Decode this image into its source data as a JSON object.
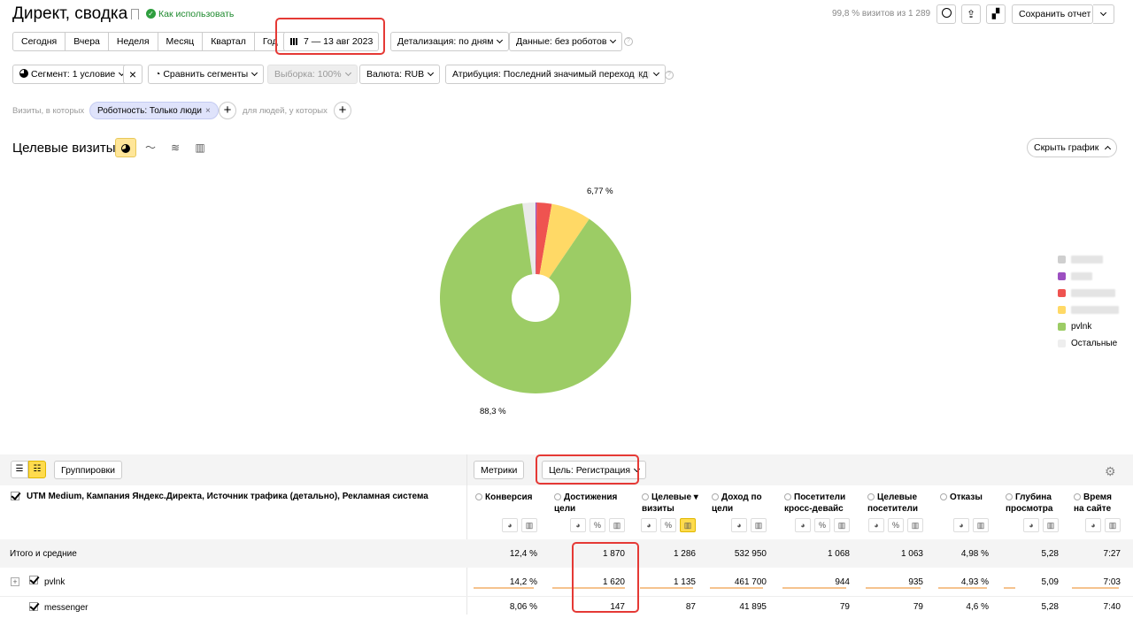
{
  "header": {
    "title": "Директ, сводка",
    "help_link": "Как использовать",
    "visits_info": "99,8 % визитов из 1 289",
    "save_label": "Сохранить отчет"
  },
  "periods": [
    "Сегодня",
    "Вчера",
    "Неделя",
    "Месяц",
    "Квартал",
    "Год"
  ],
  "date_range": "7 — 13 авг 2023",
  "detail": "Детализация: по дням",
  "data_filter": "Данные: без роботов",
  "filters": {
    "segment": "Сегмент: 1 условие",
    "compare": "Сравнить сегменты",
    "sample": "Выборка: 100%",
    "currency": "Валюта: RUB",
    "attribution": "Атрибуция: Последний значимый переход",
    "attribution_badge": "КД"
  },
  "conditions": {
    "prefix": "Визиты, в которых",
    "tag": "Роботность: Только люди",
    "people": "для людей, у которых"
  },
  "chart_section": {
    "title": "Целевые визиты",
    "hide_label": "Скрыть график"
  },
  "chart_data": {
    "type": "pie",
    "slices": [
      {
        "name": "pvlnk",
        "value": 88.3,
        "color": "#9ccc65",
        "label": "88,3 %"
      },
      {
        "name": "",
        "value": 2.2,
        "color": "#eaeaea",
        "label": ""
      },
      {
        "name": "",
        "value": 0.2,
        "color": "#9c4fc1",
        "label": ""
      },
      {
        "name": "",
        "value": 2.53,
        "color": "#ef5350",
        "label": ""
      },
      {
        "name": "",
        "value": 6.77,
        "color": "#ffd966",
        "label": "6,77 %"
      }
    ],
    "legend": [
      {
        "label": "",
        "color": "#cfcfcf",
        "blur": 36
      },
      {
        "label": "",
        "color": "#9c4fc1",
        "blur": 24
      },
      {
        "label": "",
        "color": "#ef5350",
        "blur": 50
      },
      {
        "label": "",
        "color": "#ffd966",
        "blur": 54
      },
      {
        "label": "pvlnk",
        "color": "#9ccc65",
        "blur": 0
      },
      {
        "label": "Остальные",
        "color": "#eeeeee",
        "blur": 0
      }
    ]
  },
  "table_toolbar": {
    "groups": "Группировки",
    "metrics": "Метрики",
    "goal": "Цель: Регистрация"
  },
  "table": {
    "group_header": "UTM Medium, Кампания Яндекс.Директа, Источник трафика (детально), Рекламная система",
    "columns": [
      {
        "l1": "Конверсия",
        "l2": ""
      },
      {
        "l1": "Достижения",
        "l2": "цели"
      },
      {
        "l1": "Целевые",
        "l2": "визиты"
      },
      {
        "l1": "Доход по",
        "l2": "цели"
      },
      {
        "l1": "Посетители",
        "l2": "кросс-девайс"
      },
      {
        "l1": "Целевые",
        "l2": "посетители"
      },
      {
        "l1": "Отказы",
        "l2": ""
      },
      {
        "l1": "Глубина",
        "l2": "просмотра"
      },
      {
        "l1": "Время",
        "l2": "на сайте"
      }
    ],
    "totals": {
      "label": "Итого и средние",
      "values": [
        "12,4 %",
        "1 870",
        "1 286",
        "532 950",
        "1 068",
        "1 063",
        "4,98 %",
        "5,28",
        "7:27"
      ]
    },
    "rows": [
      {
        "label": "pvlnk",
        "values": [
          "14,2 %",
          "1 620",
          "1 135",
          "461 700",
          "944",
          "935",
          "4,93 %",
          "5,09",
          "7:03"
        ]
      },
      {
        "label": "messenger",
        "values": [
          "8,06 %",
          "147",
          "87",
          "41 895",
          "79",
          "79",
          "4,6 %",
          "5,28",
          "7:40"
        ]
      }
    ]
  }
}
